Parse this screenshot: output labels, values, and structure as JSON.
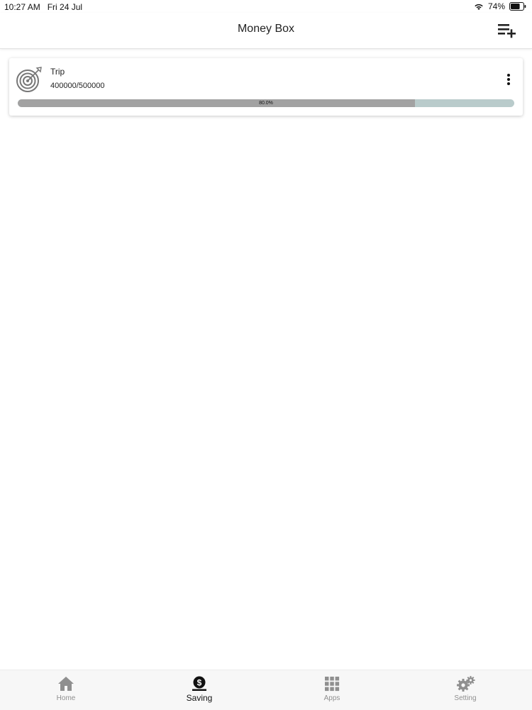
{
  "status_bar": {
    "time": "10:27 AM",
    "date": "Fri 24 Jul",
    "battery": "74%",
    "battery_level": 0.74
  },
  "header": {
    "title": "Money Box",
    "add_icon": "playlist-add-icon"
  },
  "savings": [
    {
      "name": "Trip",
      "amount_text": "400000/500000",
      "saved": 400000,
      "goal": 500000,
      "progress_percent": 80.0,
      "progress_label": "80.0%",
      "icon": "target-icon"
    }
  ],
  "tabs": [
    {
      "label": "Home",
      "icon": "home-icon",
      "active": false
    },
    {
      "label": "Saving",
      "icon": "money-bag-icon",
      "active": true
    },
    {
      "label": "Apps",
      "icon": "apps-grid-icon",
      "active": false
    },
    {
      "label": "Setting",
      "icon": "gears-icon",
      "active": false
    }
  ],
  "colors": {
    "progress_fill": "#a2a2a2",
    "progress_track": "#b9cbcb",
    "tab_active": "#111111",
    "tab_inactive": "#8f8f8f"
  }
}
